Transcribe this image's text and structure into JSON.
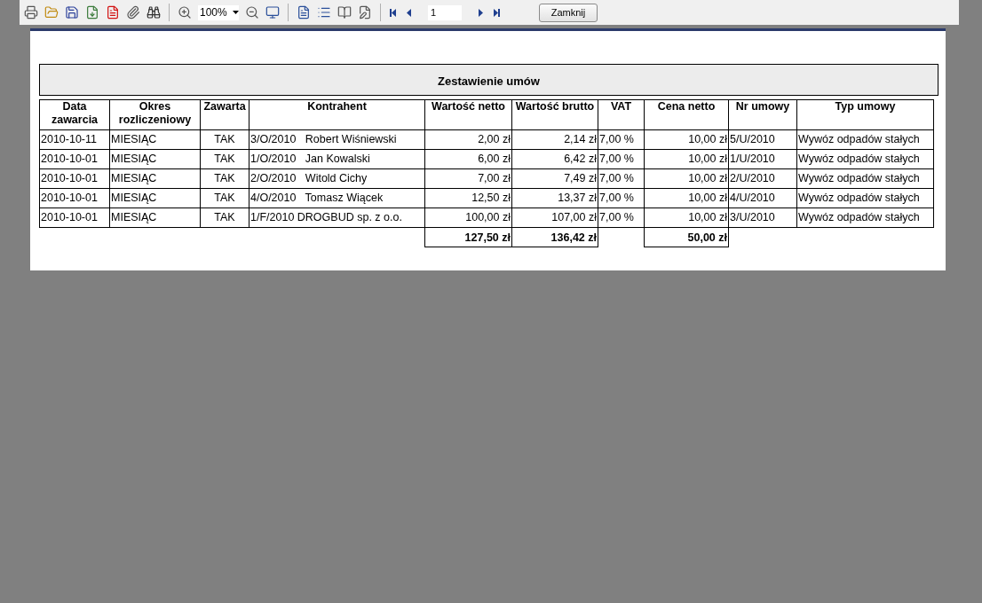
{
  "toolbar": {
    "zoom": "100%",
    "page": "1",
    "close_button": "Zamknij"
  },
  "report": {
    "title": "Zestawienie umów",
    "columns": [
      "Data zawarcia",
      "Okres rozliczeniowy",
      "Zawarta",
      "Kontrahent",
      "Wartość netto",
      "Wartość brutto",
      "VAT",
      "Cena netto",
      "Nr umowy",
      "Typ umowy"
    ],
    "rows": [
      [
        "2010-10-11",
        "MIESIĄC",
        "TAK",
        "3/O/2010   Robert Wiśniewski",
        "2,00 zł",
        "2,14 zł",
        "7,00 %",
        "10,00 zł",
        "5/U/2010",
        "Wywóz odpadów stałych"
      ],
      [
        "2010-10-01",
        "MIESIĄC",
        "TAK",
        "1/O/2010   Jan Kowalski",
        "6,00 zł",
        "6,42 zł",
        "7,00 %",
        "10,00 zł",
        "1/U/2010",
        "Wywóz odpadów stałych"
      ],
      [
        "2010-10-01",
        "MIESIĄC",
        "TAK",
        "2/O/2010   Witold Cichy",
        "7,00 zł",
        "7,49 zł",
        "7,00 %",
        "10,00 zł",
        "2/U/2010",
        "Wywóz odpadów stałych"
      ],
      [
        "2010-10-01",
        "MIESIĄC",
        "TAK",
        "4/O/2010   Tomasz Wiącek",
        "12,50 zł",
        "13,37 zł",
        "7,00 %",
        "10,00 zł",
        "4/U/2010",
        "Wywóz odpadów stałych"
      ],
      [
        "2010-10-01",
        "MIESIĄC",
        "TAK",
        "1/F/2010 DROGBUD sp. z o.o.",
        "100,00 zł",
        "107,00 zł",
        "7,00 %",
        "10,00 zł",
        "3/U/2010",
        "Wywóz odpadów stałych"
      ]
    ],
    "totals": {
      "wartosc_netto": "127,50 zł",
      "wartosc_brutto": "136,42 zł",
      "cena_netto": "50,00 zł"
    }
  }
}
